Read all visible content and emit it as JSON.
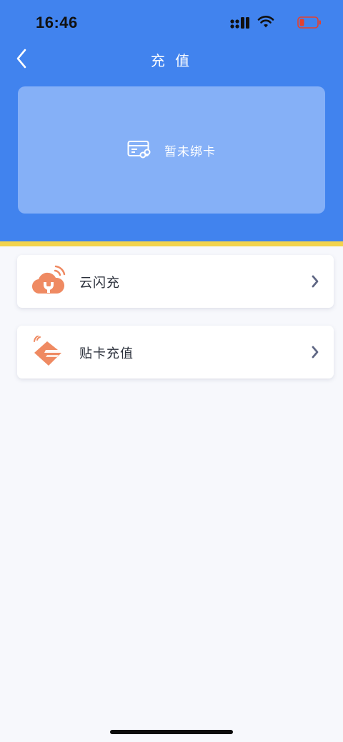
{
  "status_bar": {
    "time": "16:46",
    "battery_color": "#e5412d"
  },
  "nav": {
    "title": "充 值",
    "back_icon": "chevron-left-icon"
  },
  "card_panel": {
    "text": "暂未绑卡",
    "icon": "card-link-icon"
  },
  "options": [
    {
      "label": "云闪充",
      "icon": "cloud-flash-icon"
    },
    {
      "label": "贴卡充值",
      "icon": "tap-card-icon"
    }
  ],
  "colors": {
    "header_bg": "#4183ee",
    "card_panel_bg": "#85b0f7",
    "accent_line": "#f2d34d",
    "icon_orange": "#ef8a62",
    "page_bg": "#f7f8fc"
  }
}
